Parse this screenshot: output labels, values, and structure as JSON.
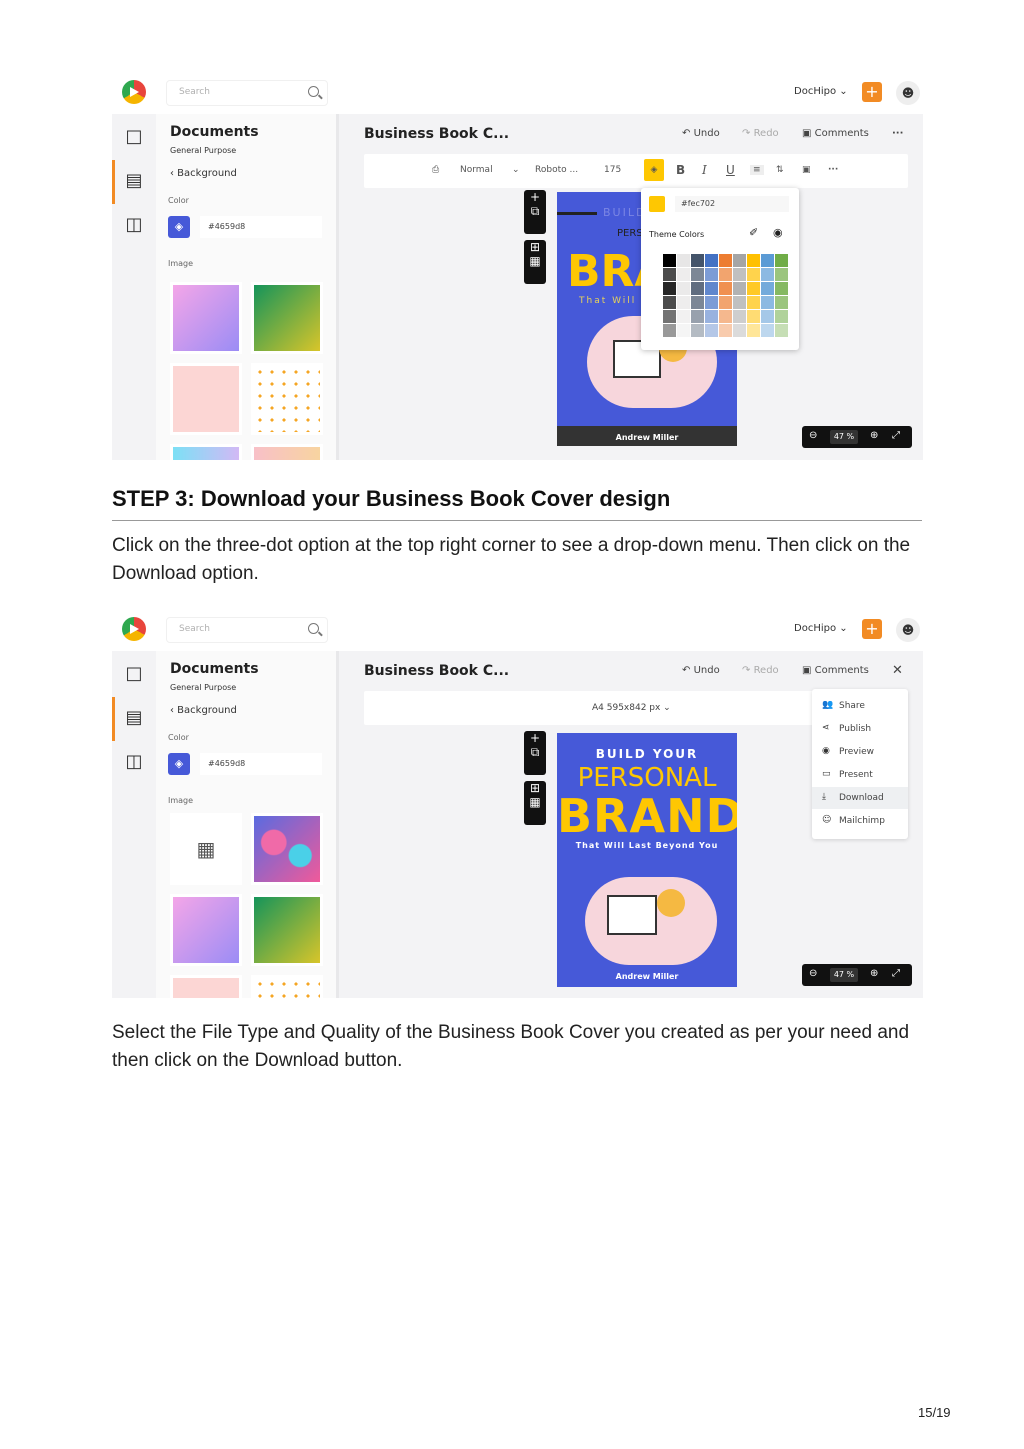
{
  "screenshot1": {
    "search_placeholder": "Search",
    "user_menu": "DocHipo ⌄",
    "panel_title": "Documents",
    "panel_subtitle": "General Purpose",
    "back_label": "‹  Background",
    "color_label": "Color",
    "color_hex": "#4659d8",
    "image_label": "Image",
    "doc_title": "Business Book C...",
    "undo": "Undo",
    "redo": "Redo",
    "comments": "Comments",
    "more": "···",
    "format": {
      "style": "Normal",
      "font": "Roboto ...",
      "size": "175"
    },
    "palette": {
      "selected_hex": "#fec702",
      "theme_label": "Theme Colors"
    },
    "cover": {
      "line1": "BUILD",
      "line2": "PERS",
      "big": "BRA",
      "tagline": "That Will La",
      "author": "Andrew Miller"
    },
    "zoom": "47 %"
  },
  "screenshot2": {
    "search_placeholder": "Search",
    "user_menu": "DocHipo ⌄",
    "panel_title": "Documents",
    "panel_subtitle": "General Purpose",
    "back_label": "‹  Background",
    "color_label": "Color",
    "color_hex": "#4659d8",
    "image_label": "Image",
    "doc_title": "Business Book C...",
    "undo": "Undo",
    "redo": "Redo",
    "comments": "Comments",
    "page_size": "A4  595x842 px  ⌄",
    "menu": [
      {
        "icon": "share-icon",
        "glyph": "👥",
        "label": "Share"
      },
      {
        "icon": "publish-icon",
        "glyph": "⋖",
        "label": "Publish"
      },
      {
        "icon": "eye-icon",
        "glyph": "◉",
        "label": "Preview"
      },
      {
        "icon": "present-icon",
        "glyph": "▭",
        "label": "Present"
      },
      {
        "icon": "download-icon",
        "glyph": "⤓",
        "label": "Download"
      },
      {
        "icon": "mailchimp-icon",
        "glyph": "☺",
        "label": "Mailchimp"
      }
    ],
    "cover": {
      "line1": "BUILD YOUR",
      "line2": "PERSONAL",
      "big": "BRAND",
      "tagline": "That Will Last Beyond You",
      "author": "Andrew Miller"
    },
    "zoom": "47 %"
  },
  "step_heading": "STEP 3: Download your Business Book Cover design",
  "paragraph1": "Click on the three-dot option at the top right corner to see a drop-down menu. Then click on the Download option.",
  "paragraph2": "Select the File Type and Quality of the Business Book Cover you created as per your need and then click on the Download button.",
  "page_number": "15/19",
  "colors": {
    "cover_blue": "#4659d8",
    "accent_orange": "#f28b24",
    "brand_yellow": "#fec702"
  }
}
